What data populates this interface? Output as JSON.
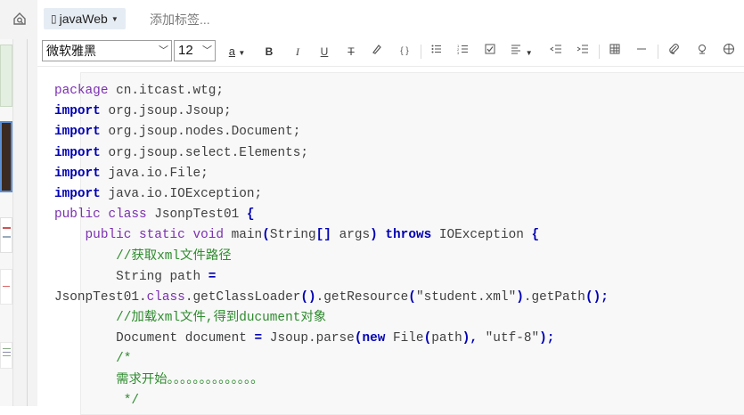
{
  "tagbar": {
    "notebook_label": "javaWeb",
    "add_tag_placeholder": "添加标签..."
  },
  "toolbar": {
    "font_family": "微软雅黑",
    "font_size": "12",
    "font_color_label": "a",
    "bold": "B",
    "italic": "I",
    "underline": "U",
    "strike": "T",
    "code": "{ }"
  },
  "code_lines": [
    [
      {
        "t": "package",
        "c": "kw2"
      },
      {
        "t": " cn.itcast.wtg;",
        "c": "pl"
      }
    ],
    [
      {
        "t": "import",
        "c": "kw"
      },
      {
        "t": " org.jsoup.Jsoup;",
        "c": "pl"
      }
    ],
    [
      {
        "t": "import",
        "c": "kw"
      },
      {
        "t": " org.jsoup.nodes.Document;",
        "c": "pl"
      }
    ],
    [
      {
        "t": "import",
        "c": "kw"
      },
      {
        "t": " org.jsoup.select.Elements;",
        "c": "pl"
      }
    ],
    [
      {
        "t": "import",
        "c": "kw"
      },
      {
        "t": " java.io.File;",
        "c": "pl"
      }
    ],
    [
      {
        "t": "import",
        "c": "kw"
      },
      {
        "t": " java.io.IOException;",
        "c": "pl"
      }
    ],
    [
      {
        "t": "public class",
        "c": "kw2"
      },
      {
        "t": " JsonpTest01 ",
        "c": "pl"
      },
      {
        "t": "{",
        "c": "kw"
      }
    ],
    [
      {
        "t": "    ",
        "c": "pl"
      },
      {
        "t": "public static void",
        "c": "kw2"
      },
      {
        "t": " main",
        "c": "pl"
      },
      {
        "t": "(",
        "c": "kw"
      },
      {
        "t": "String",
        "c": "pl"
      },
      {
        "t": "[]",
        "c": "kw"
      },
      {
        "t": " args",
        "c": "pl"
      },
      {
        "t": ")",
        "c": "kw"
      },
      {
        "t": " ",
        "c": "pl"
      },
      {
        "t": "throws",
        "c": "kw"
      },
      {
        "t": " IOException ",
        "c": "pl"
      },
      {
        "t": "{",
        "c": "kw"
      }
    ],
    [
      {
        "t": "        ",
        "c": "pl"
      },
      {
        "t": "//获取xml文件路径",
        "c": "cm"
      }
    ],
    [
      {
        "t": "        String path ",
        "c": "pl"
      },
      {
        "t": "=",
        "c": "kw"
      }
    ],
    [
      {
        "t": "JsonpTest01.",
        "c": "pl"
      },
      {
        "t": "class",
        "c": "kw2"
      },
      {
        "t": ".getClassLoader",
        "c": "pl"
      },
      {
        "t": "()",
        "c": "kw"
      },
      {
        "t": ".getResource",
        "c": "pl"
      },
      {
        "t": "(",
        "c": "kw"
      },
      {
        "t": "\"student.xml\"",
        "c": "st"
      },
      {
        "t": ")",
        "c": "kw"
      },
      {
        "t": ".getPath",
        "c": "pl"
      },
      {
        "t": "();",
        "c": "kw"
      }
    ],
    [
      {
        "t": "        ",
        "c": "pl"
      },
      {
        "t": "//加载xml文件,得到ducument对象",
        "c": "cm"
      }
    ],
    [
      {
        "t": "        Document document ",
        "c": "pl"
      },
      {
        "t": "=",
        "c": "kw"
      },
      {
        "t": " Jsoup.parse",
        "c": "pl"
      },
      {
        "t": "(",
        "c": "kw"
      },
      {
        "t": "new",
        "c": "kw"
      },
      {
        "t": " File",
        "c": "pl"
      },
      {
        "t": "(",
        "c": "kw"
      },
      {
        "t": "path",
        "c": "pl"
      },
      {
        "t": "),",
        "c": "kw"
      },
      {
        "t": " \"utf-8\"",
        "c": "st"
      },
      {
        "t": ");",
        "c": "kw"
      }
    ],
    [
      {
        "t": "        ",
        "c": "pl"
      },
      {
        "t": "/*",
        "c": "cm"
      }
    ],
    [
      {
        "t": "        ",
        "c": "pl"
      },
      {
        "t": "需求开始。。。。。。。。。。。。。。",
        "c": "cm"
      }
    ],
    [
      {
        "t": "         ",
        "c": "pl"
      },
      {
        "t": "*/",
        "c": "cm"
      }
    ]
  ]
}
